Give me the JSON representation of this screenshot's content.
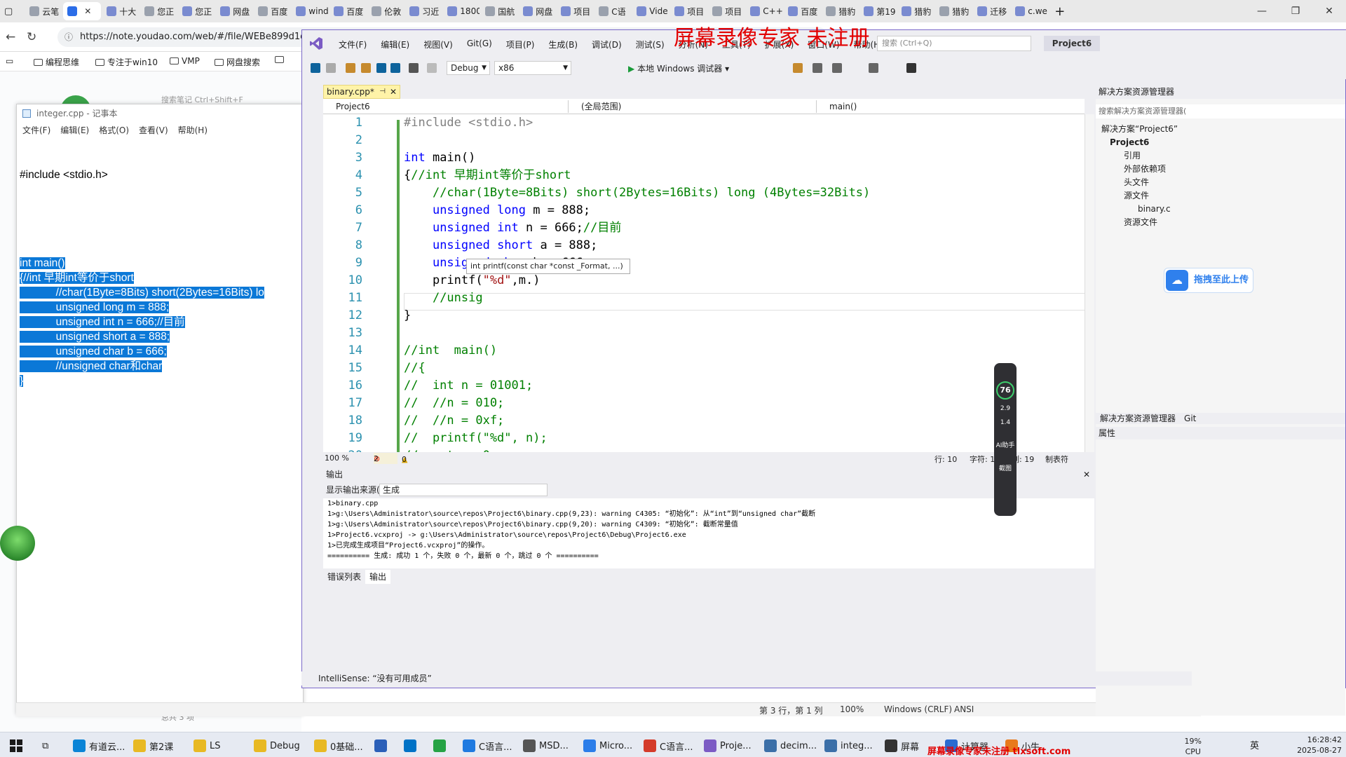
{
  "browser": {
    "tabs": [
      "云笔",
      "",
      "十大",
      "您正",
      "您正",
      "网盘",
      "百度",
      "wind",
      "百度",
      "伦敦",
      "习近",
      "1800",
      "国航",
      "网盘",
      "项目",
      "C语",
      "Vide",
      "项目",
      "项目",
      "C++",
      "百度",
      "猎豹",
      "第19",
      "猎豹",
      "猎豹",
      "迁移",
      "c.wei"
    ],
    "url": "https://note.youdao.com/web/#/file/WEBe899d1d6",
    "bookmarks": [
      "编程思维",
      "专注于win10",
      "VMP",
      "网盘搜索"
    ]
  },
  "web": {
    "search_placeholder": "搜索笔记 Ctrl+Shift+F",
    "footer": "总共 3 项"
  },
  "notepad": {
    "title": "integer.cpp - 记事本",
    "menu": [
      "文件(F)",
      "编辑(E)",
      "格式(O)",
      "查看(V)",
      "帮助(H)"
    ],
    "line1": "#include <stdio.h>",
    "selected_lines": [
      "int main()",
      "{//int 早期int等价于short",
      "            //char(1Byte=8Bits) short(2Bytes=16Bits) lo",
      "            unsigned long m = 888;",
      "            unsigned int n = 666;//目前",
      "            unsigned short a = 888;",
      "            unsigned char b = 666;",
      "            //unsigned char和char",
      "}"
    ],
    "status": {
      "pos": "第 3 行，第 1 列",
      "zoom": "100%",
      "eol": "Windows (CRLF)",
      "enc": "ANSI"
    }
  },
  "vs": {
    "menu": [
      "文件(F)",
      "编辑(E)",
      "视图(V)",
      "Git(G)",
      "项目(P)",
      "生成(B)",
      "调试(D)",
      "测试(S)",
      "分析(N)",
      "工具(T)",
      "扩展(X)",
      "窗口(W)",
      "帮助(H)"
    ],
    "search_placeholder": "搜索 (Ctrl+Q)",
    "project_badge": "Project6",
    "watermark": "屏幕录像专家 未注册",
    "config": "Debug",
    "platform": "x86",
    "run_label": "本地 Windows 调试器",
    "doc_tab": "binary.cpp*",
    "nav": {
      "project": "Project6",
      "scope": "(全局范围)",
      "member": "main()"
    },
    "line_numbers": [
      "1",
      "2",
      "3",
      "4",
      "5",
      "6",
      "7",
      "8",
      "9",
      "10",
      "11",
      "12",
      "13",
      "14",
      "15",
      "16",
      "17",
      "18",
      "19",
      "20",
      "21",
      "22",
      "23"
    ],
    "tooltip": "int printf(const char *const _Format, ...)",
    "upload": "拖拽至此上传",
    "editor_status": {
      "zoom": "100 %",
      "errors": "2",
      "warnings": "0",
      "row": "行: 10",
      "char": "字符: 16",
      "col": "列: 19",
      "tab": "制表符"
    },
    "output": {
      "title": "输出",
      "source_label": "显示输出来源(S):",
      "source": "生成",
      "lines": [
        "1>binary.cpp",
        "1>g:\\Users\\Administrator\\source\\repos\\Project6\\binary.cpp(9,23): warning C4305: “初始化”: 从“int”到“unsigned char”截断",
        "1>g:\\Users\\Administrator\\source\\repos\\Project6\\binary.cpp(9,20): warning C4309: “初始化”: 截断常量值",
        "1>Project6.vcxproj -> g:\\Users\\Administrator\\source\\repos\\Project6\\Debug\\Project6.exe",
        "1>已完成生成项目“Project6.vcxproj”的操作。",
        "========== 生成: 成功 1 个，失败 0 个，最新 0 个，跳过 0 个 =========="
      ],
      "tabs": [
        "错误列表",
        "输出"
      ]
    },
    "intellisense": "IntelliSense: “没有可用成员”",
    "solution": {
      "title": "解决方案资源管理器",
      "search": "搜索解决方案资源管理器(",
      "tree": [
        "解决方案“Project6”",
        "Project6",
        "引用",
        "外部依赖项",
        "头文件",
        "源文件",
        "binary.c",
        "资源文件"
      ],
      "tabs": [
        "解决方案资源管理器",
        "Git"
      ],
      "props": "属性"
    },
    "widget": {
      "pct": "76",
      "up": "2.9",
      "down": "1.4",
      "ai": "AI助手",
      "shot": "截图"
    }
  },
  "taskbar": {
    "items": [
      "有道云...",
      "第2课",
      "LS",
      "Debug",
      "0基础...",
      "",
      "",
      "",
      "C语言...",
      "MSD...",
      "Micro...",
      "C语言...",
      "Proje...",
      "decim...",
      "integ...",
      "屏幕",
      "计算器",
      "小牛"
    ],
    "cpu": "19%",
    "cpu_label": "CPU利用率",
    "ime": "英",
    "time": "16:28:42",
    "date": "2025-08-27",
    "watermark": "屏幕录像专家未注册 tlxsoft.com"
  }
}
